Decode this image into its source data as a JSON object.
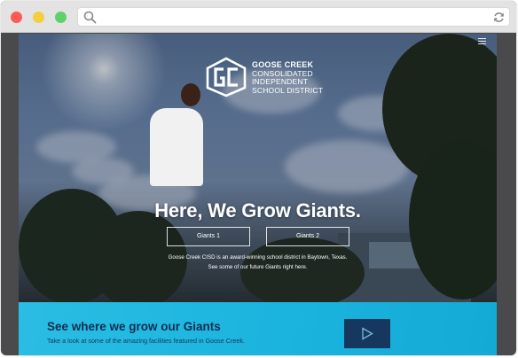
{
  "browser": {
    "window_dots": [
      "close",
      "minimize",
      "maximize"
    ],
    "search_icon": "search-icon",
    "reload_icon": "reload-icon"
  },
  "logo": {
    "monogram": "GC",
    "line1": "GOOSE CREEK",
    "line2": "CONSOLIDATED",
    "line3": "INDEPENDENT",
    "line4": "SCHOOL DISTRICT"
  },
  "nav": {
    "menu_icon": "hamburger-icon"
  },
  "hero": {
    "headline": "Here, We Grow Giants.",
    "button1": "Giants 1",
    "button2": "Giants 2",
    "tagline1": "Goose Creek CISD is an award-winning school district in Baytown, Texas.",
    "tagline2": "See some of our future Giants right here."
  },
  "band": {
    "title": "See where we grow our Giants",
    "subtitle": "Take a look at some of the amazing facilities featured in Goose Creek.",
    "play_icon": "play-icon"
  },
  "colors": {
    "band_bg": "#1ab4de",
    "band_text": "#0f2e52",
    "play_button_bg": "#16385f"
  }
}
